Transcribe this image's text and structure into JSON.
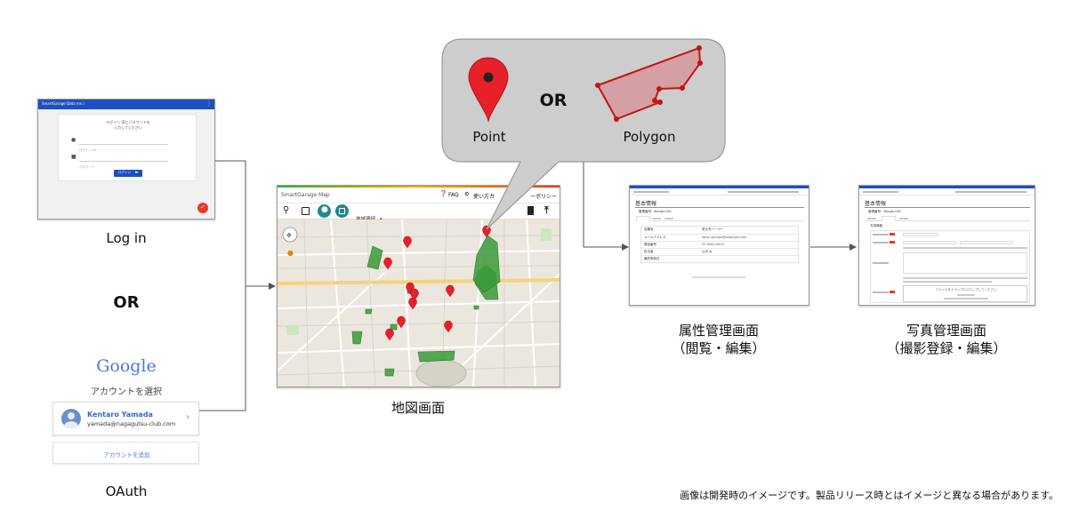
{
  "login": {
    "app_title": "SmartGarage Data mn.i",
    "prompt_line1": "ログイン IDとパスワードを",
    "prompt_line2": "入力してください",
    "id_placeholder": "ログイン ID",
    "password_placeholder": "パスワード",
    "login_button": "ログイン",
    "caption": "Log in"
  },
  "or_label": "OR",
  "oauth": {
    "google_logo": "Google",
    "choose_account": "アカウントを選択",
    "account_name": "Kentaro Yamada",
    "account_email": "yamada@nagagutsu-club.com",
    "add_account": "アカウントを追加",
    "caption": "OAuth"
  },
  "map": {
    "app_title": "SmartGarage Map",
    "faq": "FAQ",
    "help": "使い方ガ",
    "policy": "ーポリシー",
    "region_select": "地域選択",
    "map_toggle": "地図",
    "satellite_toggle": "航空写真",
    "caption": "地図画面"
  },
  "bubble": {
    "or_label": "OR",
    "point_label": "Point",
    "polygon_label": "Polygon"
  },
  "attribute": {
    "heading": "基本情報",
    "management_no": "管理番号：Burger-001",
    "caption_line1": "属性管理画面",
    "caption_line2": "（閲覧・編集）",
    "rows": [
      {
        "label": "店舗名",
        "value": "恵比寿バーガー"
      },
      {
        "label": "メールアドレス",
        "value": "ebisu.sample@example.com"
      },
      {
        "label": "電話番号",
        "value": "03-0000-0000"
      },
      {
        "label": "担当者",
        "value": "山田 太"
      },
      {
        "label": "最終更新日",
        "value": ""
      }
    ]
  },
  "photo": {
    "heading": "基本情報",
    "management_no": "管理番号：Burger-001",
    "caption_line1": "写真管理画面",
    "caption_line2": "（撮影登録・編集）",
    "section": "写真情報",
    "upload_text": "ファイルをドラッグ&ドロップしてください"
  },
  "disclaimer": "画像は開発時のイメージです。製品リリース時とはイメージと異なる場合があります。",
  "colors": {
    "header_blue": "#1d4fbf",
    "pin_red": "#e8202a",
    "polygon_fill": "#d4a0a4",
    "polygon_stroke": "#c41414",
    "map_green": "#3a9a3a",
    "teal": "#1f8a8a"
  }
}
